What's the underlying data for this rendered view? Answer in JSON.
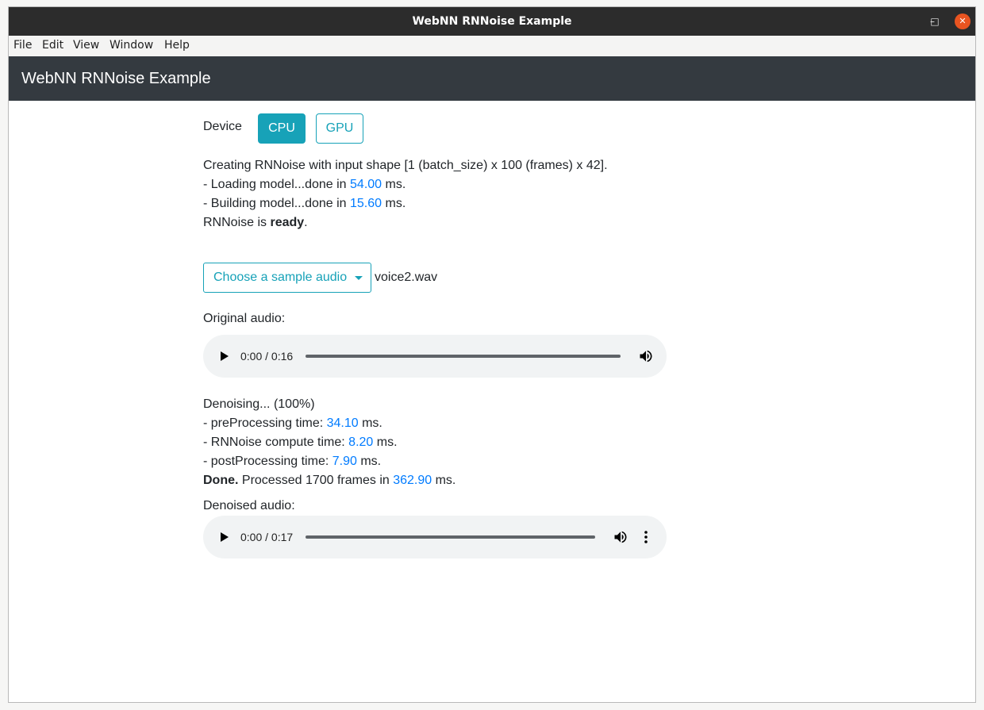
{
  "window": {
    "title": "WebNN RNNoise Example",
    "controls": {
      "minimize": "–",
      "maximize": "□",
      "close": "✕"
    }
  },
  "menu": {
    "file": "File",
    "edit": "Edit",
    "view": "View",
    "window": "Window",
    "help": "Help"
  },
  "header": {
    "brand": "WebNN RNNoise Example"
  },
  "device": {
    "label": "Device",
    "cpu": "CPU",
    "gpu": "GPU",
    "selected": "CPU"
  },
  "status": {
    "line1": "Creating RNNoise with input shape [1 (batch_size) x 100 (frames) x 42].",
    "loading_prefix": "- Loading model...done in ",
    "loading_value": "54.00",
    "building_prefix": "- Building model...done in ",
    "building_value": "15.60",
    "ms": " ms.",
    "ready_prefix": "RNNoise is ",
    "ready_word": "ready",
    "ready_suffix": "."
  },
  "sample": {
    "dropdown_label": "Choose a sample audio",
    "filename": "voice2.wav"
  },
  "original": {
    "label": "Original audio:",
    "time": "0:00 / 0:16"
  },
  "denoise": {
    "progress": "Denoising... (100%)",
    "pre_prefix": "- preProcessing time: ",
    "pre_value": "34.10",
    "compute_prefix": "- RNNoise compute time: ",
    "compute_value": "8.20",
    "post_prefix": "- postProcessing time: ",
    "post_value": "7.90",
    "ms": " ms.",
    "done_word": "Done.",
    "done_text": " Processed 1700 frames in ",
    "done_value": "362.90"
  },
  "denoised": {
    "label": "Denoised audio:",
    "time": "0:00 / 0:17"
  },
  "colors": {
    "accent": "#17a2b8",
    "link": "#007bff",
    "header_bg": "#343a40",
    "titlebar_bg": "#2c2c2c",
    "close_button": "#e95420"
  }
}
